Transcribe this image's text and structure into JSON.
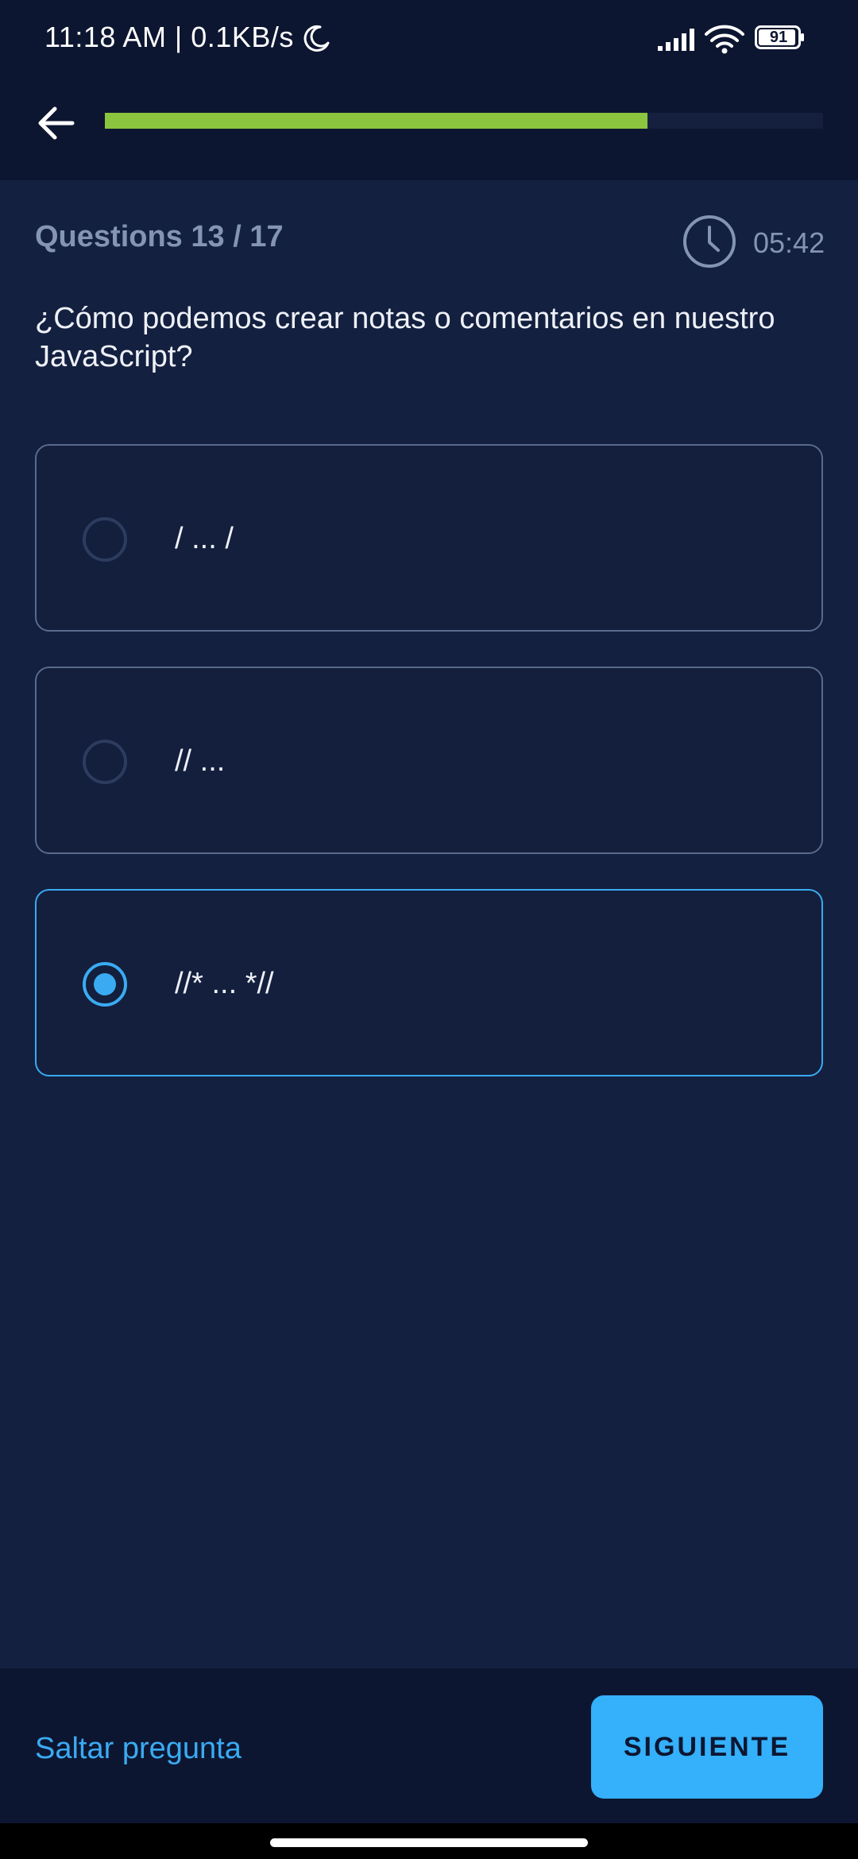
{
  "status_bar": {
    "time": "11:18 AM | 0.1KB/s",
    "battery": "91",
    "icons": [
      "moon-icon",
      "signal-icon",
      "wifi-icon",
      "battery-icon"
    ]
  },
  "top_bar": {
    "back_icon": "arrow-left-icon",
    "progress_fraction": 0.755,
    "progress_color": "#8bc43f"
  },
  "quiz": {
    "question_count": "Questions 13 / 17",
    "timer": "05:42",
    "question": "¿Cómo podemos crear notas o comentarios en nuestro JavaScript?",
    "options": [
      {
        "label": "/ ... /",
        "selected": false
      },
      {
        "label": "// ...",
        "selected": false
      },
      {
        "label": "//* ... *//",
        "selected": true
      }
    ]
  },
  "footer": {
    "skip_label": "Saltar pregunta",
    "next_label": "SIGUIENTE"
  },
  "colors": {
    "accent": "#3aabf2",
    "background": "#14203f",
    "bar_background": "#0d1631"
  }
}
